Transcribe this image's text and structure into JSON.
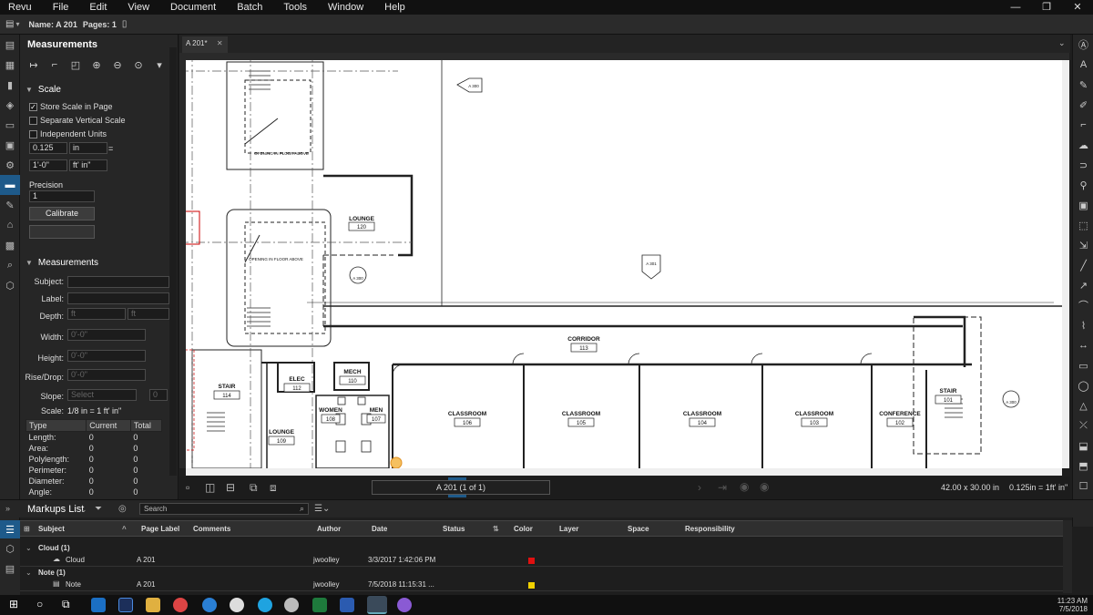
{
  "menu": [
    "Revu",
    "File",
    "Edit",
    "View",
    "Document",
    "Batch",
    "Tools",
    "Window",
    "Help"
  ],
  "file_bar": {
    "name_label": "Name: A 201",
    "pages_label": "Pages: 1"
  },
  "panel": {
    "title": "Measurements",
    "scale_section": "Scale",
    "store_scale": "Store Scale in Page",
    "separate_vertical": "Separate Vertical Scale",
    "independent_units": "Independent Units",
    "scale_value": "0.125",
    "scale_unit": "in",
    "scale_equals": "=",
    "real_value": "1'-0\"",
    "real_unit": "ft' in\"",
    "precision_label": "Precision",
    "precision_value": "1",
    "calibrate": "Calibrate",
    "measurements_section": "Measurements",
    "subject_label": "Subject:",
    "label_label": "Label:",
    "depth_label": "Depth:",
    "depth_value": "ft",
    "depth_unit": "ft",
    "width_label": "Width:",
    "width_value": "0'-0\"",
    "height_label": "Height:",
    "height_value": "0'-0\"",
    "rise_label": "Rise/Drop:",
    "rise_value": "0'-0\"",
    "slope_label": "Slope:",
    "slope_value": "Select",
    "slope_num": "0",
    "scale_label": "Scale:",
    "scale_text": "1/8 in = 1 ft' in\"",
    "table_headers": [
      "Type",
      "Current",
      "Total"
    ],
    "table_rows": [
      [
        "Length:",
        "0",
        "0"
      ],
      [
        "Area:",
        "0",
        "0"
      ],
      [
        "Polylength:",
        "0",
        "0"
      ],
      [
        "Perimeter:",
        "0",
        "0"
      ],
      [
        "Diameter:",
        "0",
        "0"
      ],
      [
        "Angle:",
        "0",
        "0"
      ]
    ]
  },
  "doc_tab": "A 201*",
  "drawing": {
    "rooms": [
      {
        "name": "LOUNGE",
        "num": "120"
      },
      {
        "name": "CORRIDOR",
        "num": "113"
      },
      {
        "name": "STAIR",
        "num": "114"
      },
      {
        "name": "ELEC",
        "num": "112"
      },
      {
        "name": "MECH",
        "num": "110"
      },
      {
        "name": "WOMEN",
        "num": "108"
      },
      {
        "name": "MEN",
        "num": "107"
      },
      {
        "name": "LOUNGE",
        "num": "109"
      },
      {
        "name": "CLASSROOM",
        "num": "106"
      },
      {
        "name": "CLASSROOM",
        "num": "105"
      },
      {
        "name": "CLASSROOM",
        "num": "104"
      },
      {
        "name": "CLASSROOM",
        "num": "103"
      },
      {
        "name": "CONFERENCE",
        "num": "102"
      },
      {
        "name": "STAIR",
        "num": "101"
      }
    ],
    "notes": [
      "OPENING IN FLOOR ABOVE",
      "OPENING IN FLOOR ABOVE"
    ],
    "tags": [
      "A 300",
      "A 301",
      "A 300",
      "A 300"
    ]
  },
  "nav": {
    "page": "A 201 (1 of 1)",
    "size": "42.00 x 30.00 in",
    "scale": "0.125in = 1ft' in\""
  },
  "markups": {
    "title": "Markups List",
    "search_placeholder": "Search",
    "columns": [
      "Subject",
      "Page Label",
      "Comments",
      "Author",
      "Date",
      "Status",
      "Color",
      "Layer",
      "Space",
      "Responsibility"
    ],
    "groups": [
      {
        "group": "Cloud (1)",
        "subject": "Cloud",
        "page": "A 201",
        "author": "jwoolley",
        "date": "3/3/2017 1:42:06 PM",
        "color": "#e01010"
      },
      {
        "group": "Note (1)",
        "subject": "Note",
        "page": "A 201",
        "author": "jwoolley",
        "date": "7/5/2018 11:15:31 ...",
        "color": "#f0d000"
      }
    ]
  },
  "clock": {
    "time": "11:23 AM",
    "date": "7/5/2018"
  }
}
